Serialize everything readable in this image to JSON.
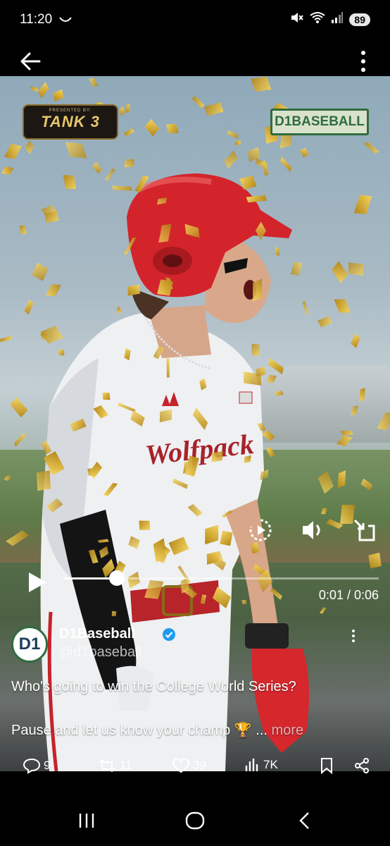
{
  "status": {
    "time": "11:20",
    "battery": "89"
  },
  "video": {
    "sponsor_small": "PRESENTED BY:",
    "sponsor_logo": "TANK 3",
    "brand_logo": "D1BASEBALL",
    "jersey_text": "Wolfpack",
    "time_readout": "0:01 / 0:06",
    "progress": 0.17
  },
  "tweet": {
    "avatar_text": "D1",
    "display_name": "D1Baseball",
    "handle": "@d1baseball",
    "line1": "Who's going to win the College World Series?",
    "line2": "Pause and let us know your champ 🏆 ...",
    "more": "more"
  },
  "actions": {
    "replies": "9",
    "reposts": "11",
    "likes": "39",
    "views": "7K"
  },
  "icons": {
    "back": "arrow-left-icon",
    "menu": "more-vertical-icon",
    "replay": "replay-icon",
    "volume": "volume-icon",
    "exit_fullscreen": "exit-fullscreen-icon",
    "play": "play-icon",
    "verified": "verified-badge-icon",
    "reply": "reply-icon",
    "repost": "repost-icon",
    "like": "heart-icon",
    "views": "views-icon",
    "bookmark": "bookmark-icon",
    "share": "share-icon"
  },
  "colors": {
    "verified": "#1d9bf0",
    "helmet": "#d3242b",
    "brand_green": "#2f6d3e"
  }
}
